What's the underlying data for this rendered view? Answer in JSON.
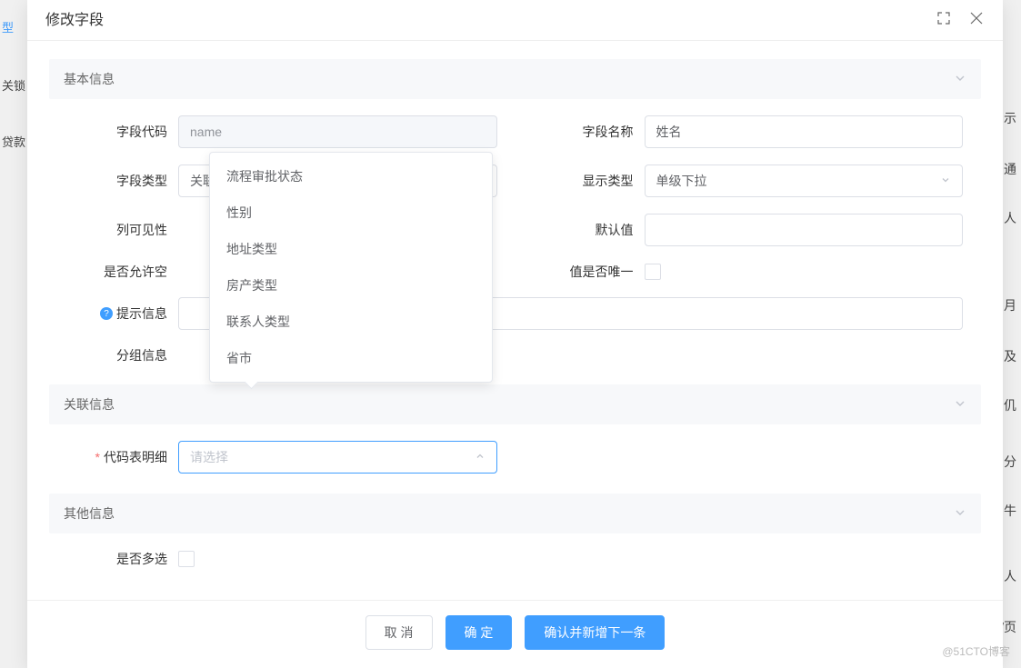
{
  "modal": {
    "title": "修改字段"
  },
  "sections": {
    "basic": "基本信息",
    "relation": "关联信息",
    "other": "其他信息"
  },
  "labels": {
    "field_code": "字段代码",
    "field_name": "字段名称",
    "field_type": "字段类型",
    "display_type": "显示类型",
    "col_visible": "列可见性",
    "default_value": "默认值",
    "allow_null": "是否允许空",
    "value_unique": "值是否唯一",
    "tip_info": "提示信息",
    "group_info": "分组信息",
    "code_table_detail": "代码表明细",
    "multi_select": "是否多选"
  },
  "values": {
    "field_code": "name",
    "field_name": "姓名",
    "field_type": "关联-码表",
    "display_type": "单级下拉",
    "default_value": "",
    "tip_info": "",
    "code_table_placeholder": "请选择"
  },
  "dropdown_options": [
    "流程审批状态",
    "性别",
    "地址类型",
    "房产类型",
    "联系人类型",
    "省市"
  ],
  "buttons": {
    "cancel": "取 消",
    "confirm": "确 定",
    "confirm_next": "确认并新增下一条"
  },
  "watermark": "@51CTO博客",
  "bg": {
    "left1": "型",
    "left2": "关锁",
    "left3": "贷款",
    "r1": "示",
    "r2": "通",
    "r3": "人",
    "r4": "月",
    "r5": "及",
    "r6": "仉",
    "r7": "分",
    "r8": "牛",
    "r9": "人",
    "r10": "/页"
  }
}
